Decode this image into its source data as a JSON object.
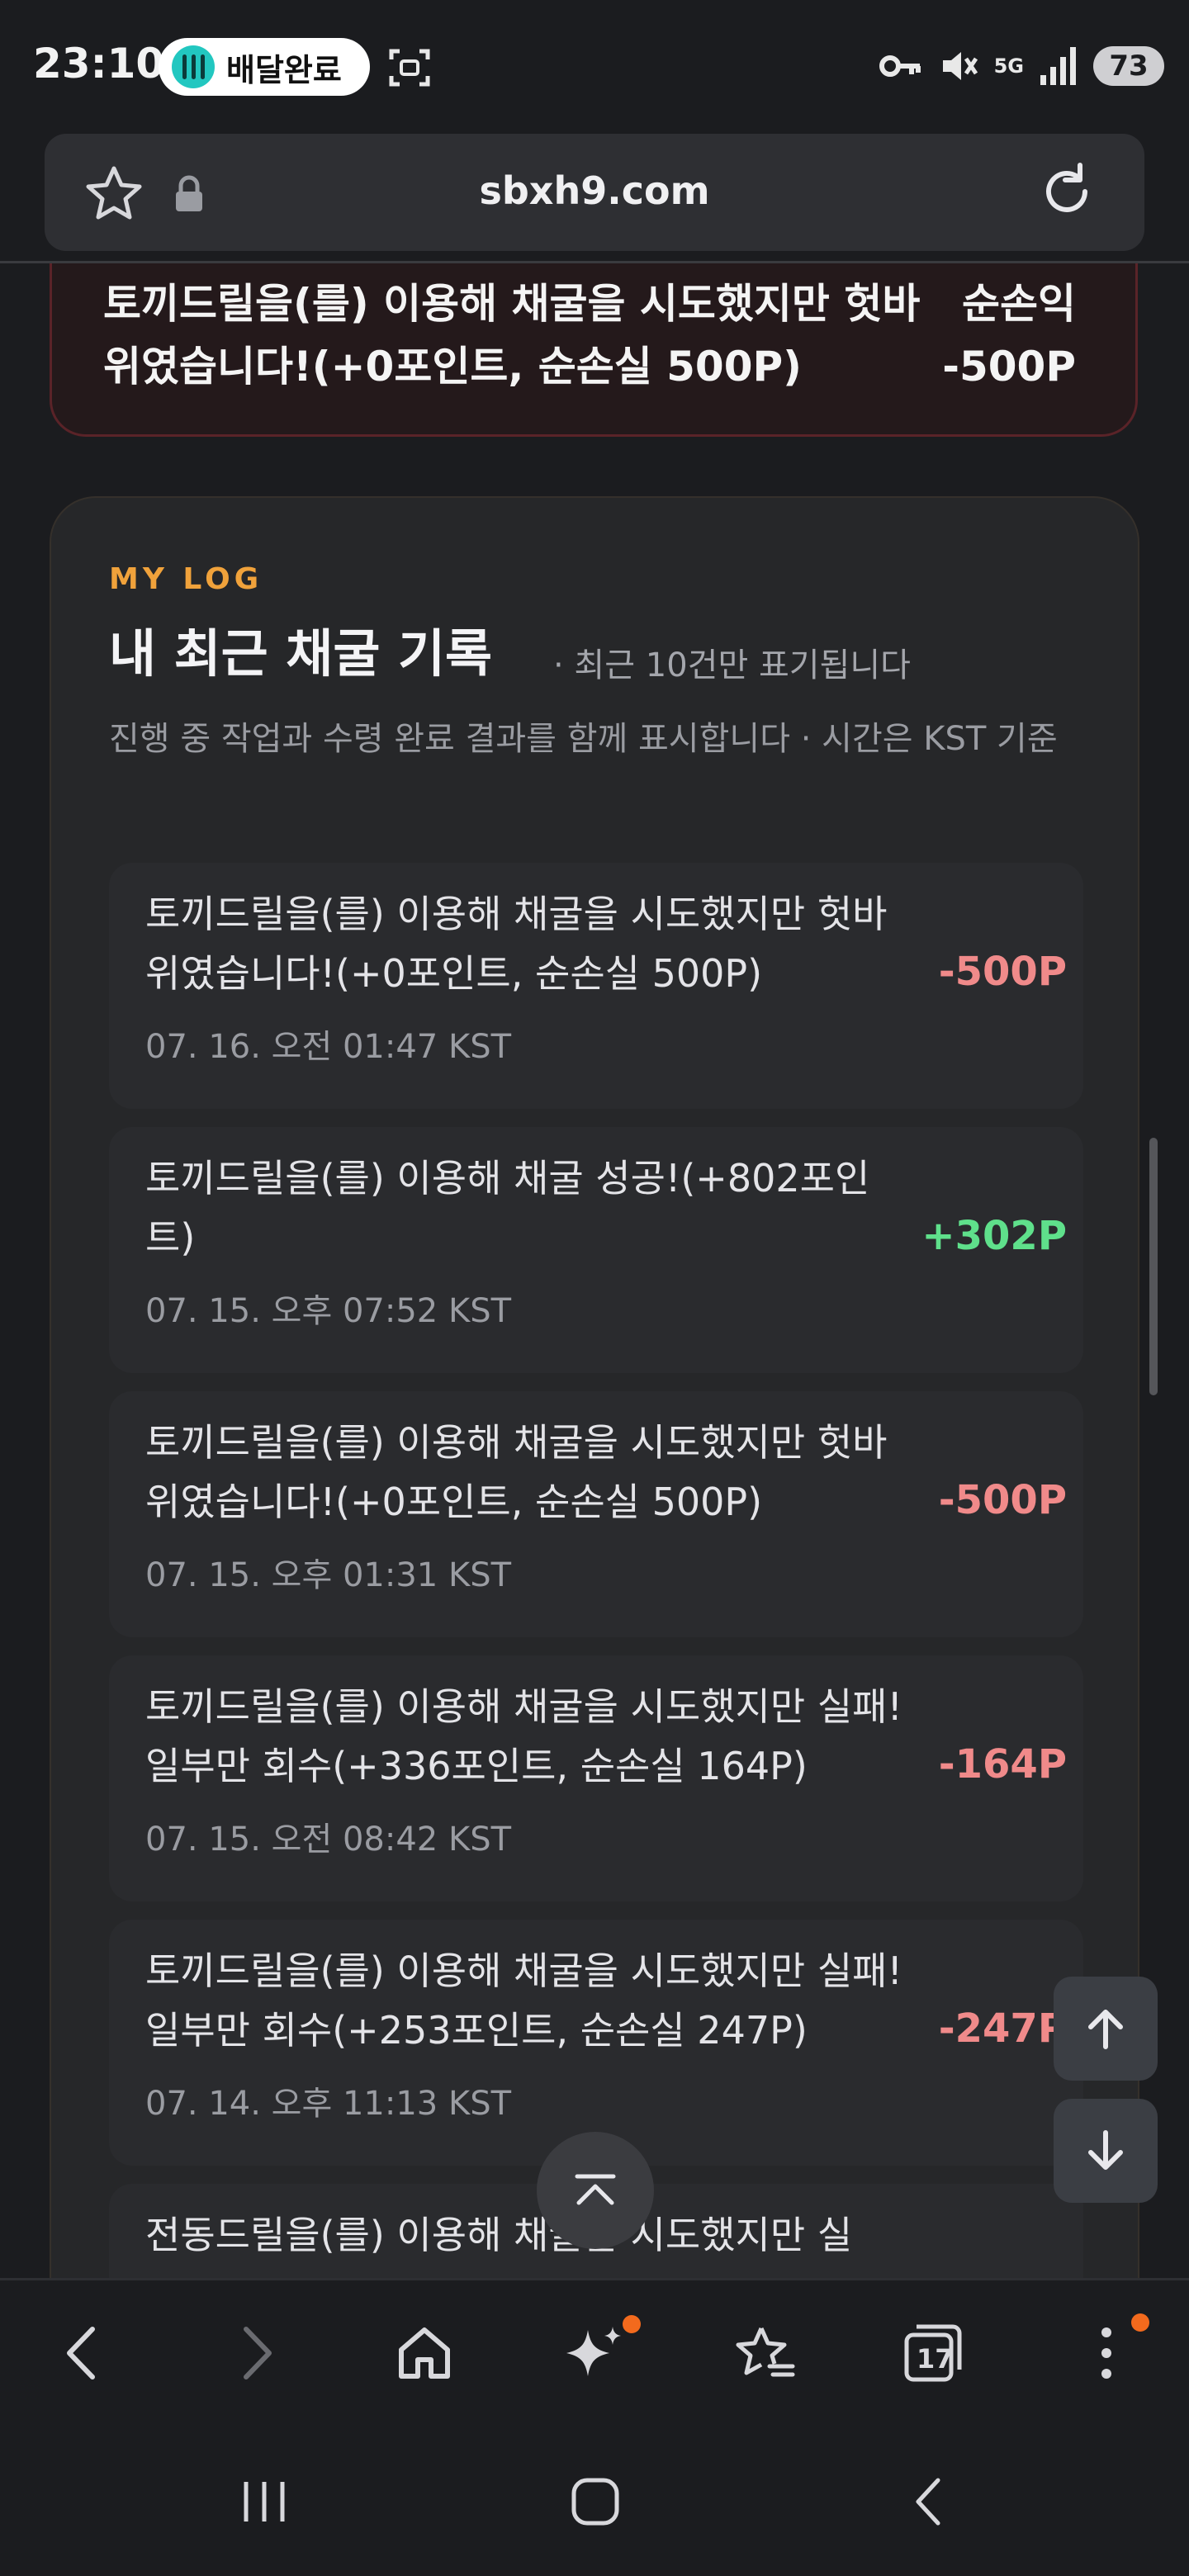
{
  "status_bar": {
    "time": "23:10",
    "notification": "배달완료",
    "battery": "73",
    "network": "5G"
  },
  "browser": {
    "url": "sbxh9.com",
    "tab_count": "17"
  },
  "top_card": {
    "text": "토끼드릴을(를) 이용해 채굴을 시도했지만 헛바위였습니다!(+0포인트, 순손실 500P)",
    "label": "순손익",
    "amount": "-500P"
  },
  "log_section": {
    "eyebrow": "MY LOG",
    "title": "내 최근 채굴 기록",
    "note": "· 최근 10건만 표기됩니다",
    "description": "진행 중 작업과 수령 완료 결과를 함께 표시합니다 · 시간은 KST 기준",
    "items": [
      {
        "text": "토끼드릴을(를) 이용해 채굴을 시도했지만 헛바위였습니다!(+0포인트, 순손실 500P)",
        "time": "07. 16. 오전 01:47 KST",
        "amount": "-500P",
        "sign": "neg"
      },
      {
        "text": "토끼드릴을(를) 이용해 채굴 성공!(+802포인트)",
        "time": "07. 15. 오후 07:52 KST",
        "amount": "+302P",
        "sign": "pos"
      },
      {
        "text": "토끼드릴을(를) 이용해 채굴을 시도했지만 헛바위였습니다!(+0포인트, 순손실 500P)",
        "time": "07. 15. 오후 01:31 KST",
        "amount": "-500P",
        "sign": "neg"
      },
      {
        "text": "토끼드릴을(를) 이용해 채굴을 시도했지만 실패! 일부만 회수(+336포인트, 순손실 164P)",
        "time": "07. 15. 오전 08:42 KST",
        "amount": "-164P",
        "sign": "neg"
      },
      {
        "text": "토끼드릴을(를) 이용해 채굴을 시도했지만 실패! 일부만 회수(+253포인트, 순손실 247P)",
        "time": "07. 14. 오후 11:13 KST",
        "amount": "-247P",
        "sign": "neg"
      },
      {
        "text": "전동드릴을(를) 이용해 채굴을 시도했지만 실",
        "time": "",
        "amount": "",
        "sign": "neg"
      }
    ]
  },
  "colors": {
    "accent": "#f0a23b",
    "negative": "#f08a8a",
    "positive": "#5fe08b",
    "badge": "#f36a1d"
  }
}
